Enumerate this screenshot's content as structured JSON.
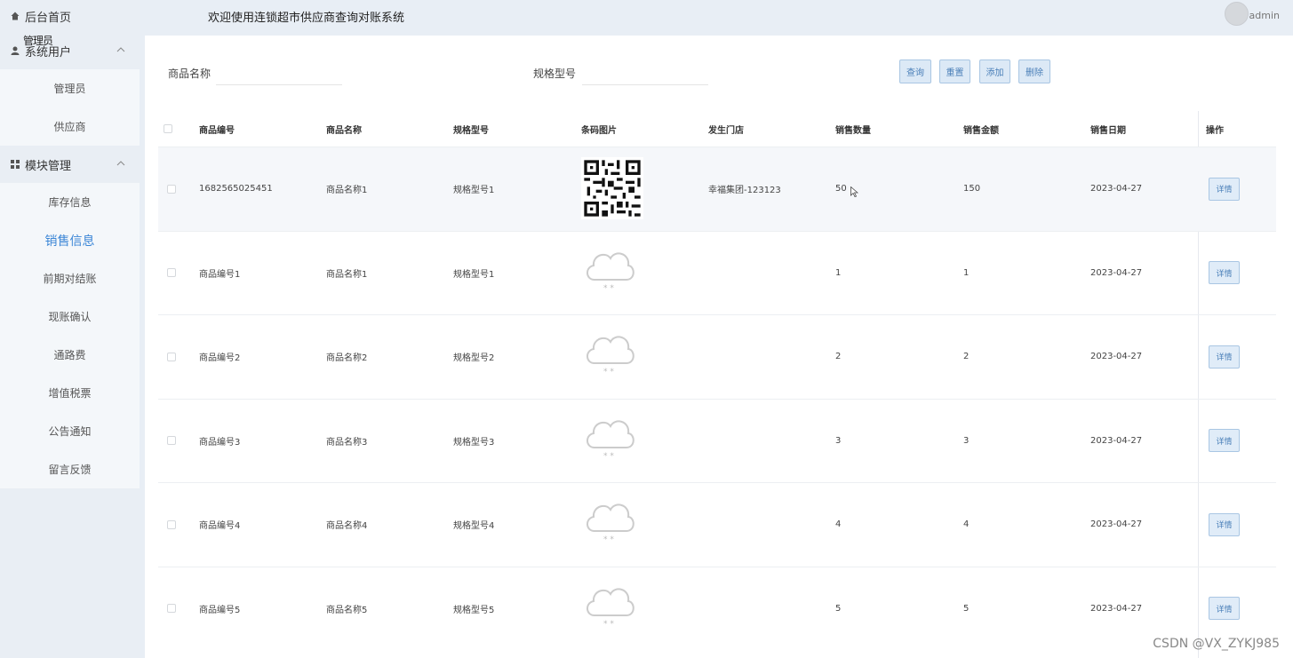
{
  "sidebar": {
    "home_label": "后台首页",
    "overlap_text": "管理员",
    "groups": [
      {
        "title": "系统用户",
        "items": [
          "管理员",
          "供应商"
        ]
      },
      {
        "title": "模块管理",
        "items": [
          "库存信息",
          "销售信息",
          "前期对结账",
          "现账确认",
          "通路费",
          "增值税票",
          "公告通知",
          "留言反馈"
        ]
      }
    ],
    "active_item": "销售信息"
  },
  "header": {
    "title": "欢迎使用连锁超市供应商查询对账系统",
    "user": "admin"
  },
  "search": {
    "name_label": "商品名称",
    "name_value": "",
    "spec_label": "规格型号",
    "spec_value": "",
    "buttons": [
      "查询",
      "重置",
      "添加",
      "删除"
    ]
  },
  "table": {
    "columns": [
      "商品编号",
      "商品名称",
      "规格型号",
      "条码图片",
      "发生门店",
      "销售数量",
      "销售金额",
      "销售日期",
      "操作"
    ],
    "detail_label": "详情",
    "rows": [
      {
        "code": "1682565025451",
        "name": "商品名称1",
        "spec": "规格型号1",
        "image": "qr",
        "store": "幸福集团-123123",
        "qty": "50",
        "amount": "150",
        "date": "2023-04-27"
      },
      {
        "code": "商品编号1",
        "name": "商品名称1",
        "spec": "规格型号1",
        "image": "cloud",
        "store": "",
        "qty": "1",
        "amount": "1",
        "date": "2023-04-27"
      },
      {
        "code": "商品编号2",
        "name": "商品名称2",
        "spec": "规格型号2",
        "image": "cloud",
        "store": "",
        "qty": "2",
        "amount": "2",
        "date": "2023-04-27"
      },
      {
        "code": "商品编号3",
        "name": "商品名称3",
        "spec": "规格型号3",
        "image": "cloud",
        "store": "",
        "qty": "3",
        "amount": "3",
        "date": "2023-04-27"
      },
      {
        "code": "商品编号4",
        "name": "商品名称4",
        "spec": "规格型号4",
        "image": "cloud",
        "store": "",
        "qty": "4",
        "amount": "4",
        "date": "2023-04-27"
      },
      {
        "code": "商品编号5",
        "name": "商品名称5",
        "spec": "规格型号5",
        "image": "cloud",
        "store": "",
        "qty": "5",
        "amount": "5",
        "date": "2023-04-27"
      }
    ]
  },
  "watermark": "CSDN @VX_ZYKJ985",
  "colors": {
    "accent": "#3b86d6",
    "button_bg": "#dce9f6",
    "sidebar_bg": "#e9eef4"
  }
}
